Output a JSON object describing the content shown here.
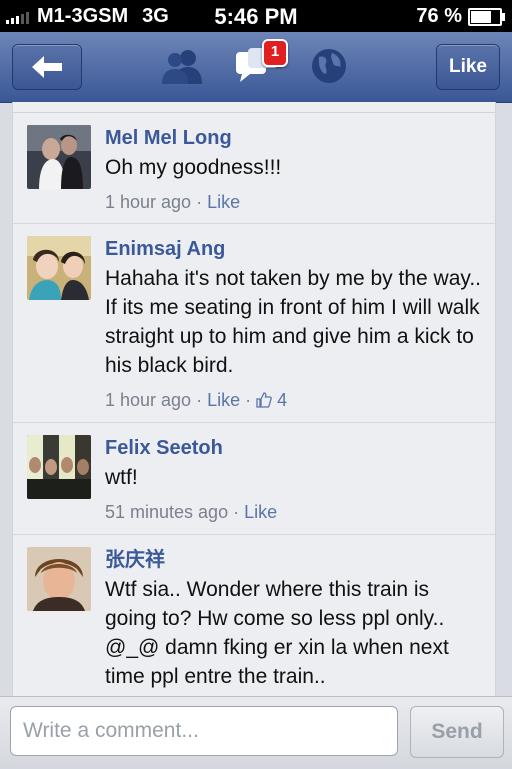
{
  "status_bar": {
    "carrier": "M1-3GSM",
    "network": "3G",
    "time": "5:46 PM",
    "battery_text": "76 %",
    "battery_level": 0.76
  },
  "nav": {
    "like_label": "Like",
    "notification_count": "1",
    "icons": [
      "back-arrow-icon",
      "friends-icon",
      "messages-icon",
      "globe-icon"
    ]
  },
  "comments": [
    {
      "name": "Mel Mel Long",
      "text": "Oh my goodness!!!",
      "time": "1 hour ago",
      "sep": " · ",
      "like": "Like",
      "likes": ""
    },
    {
      "name": "Enimsaj Ang",
      "text": "Hahaha it's not taken by me by the way.. If its me seating in front of him I will walk straight up to him and give him a kick to his black bird.",
      "time": "1 hour ago",
      "sep": " · ",
      "like": "Like",
      "sep2": " · ",
      "likes": "4"
    },
    {
      "name": "Felix Seetoh",
      "text": "wtf!",
      "time": "51 minutes ago",
      "sep": " · ",
      "like": "Like",
      "likes": ""
    },
    {
      "name": "张庆祥",
      "text": "Wtf sia.. Wonder where this train is going to? Hw come so less ppl only.. @_@ damn fking er xin la when next time ppl entre the train..",
      "time": "",
      "like": "",
      "likes": ""
    }
  ],
  "composer": {
    "placeholder": "Write a comment...",
    "send_label": "Send"
  },
  "colors": {
    "nav_blue": "#3b5998",
    "name_blue": "#3b5998",
    "badge_red": "#e02020"
  }
}
